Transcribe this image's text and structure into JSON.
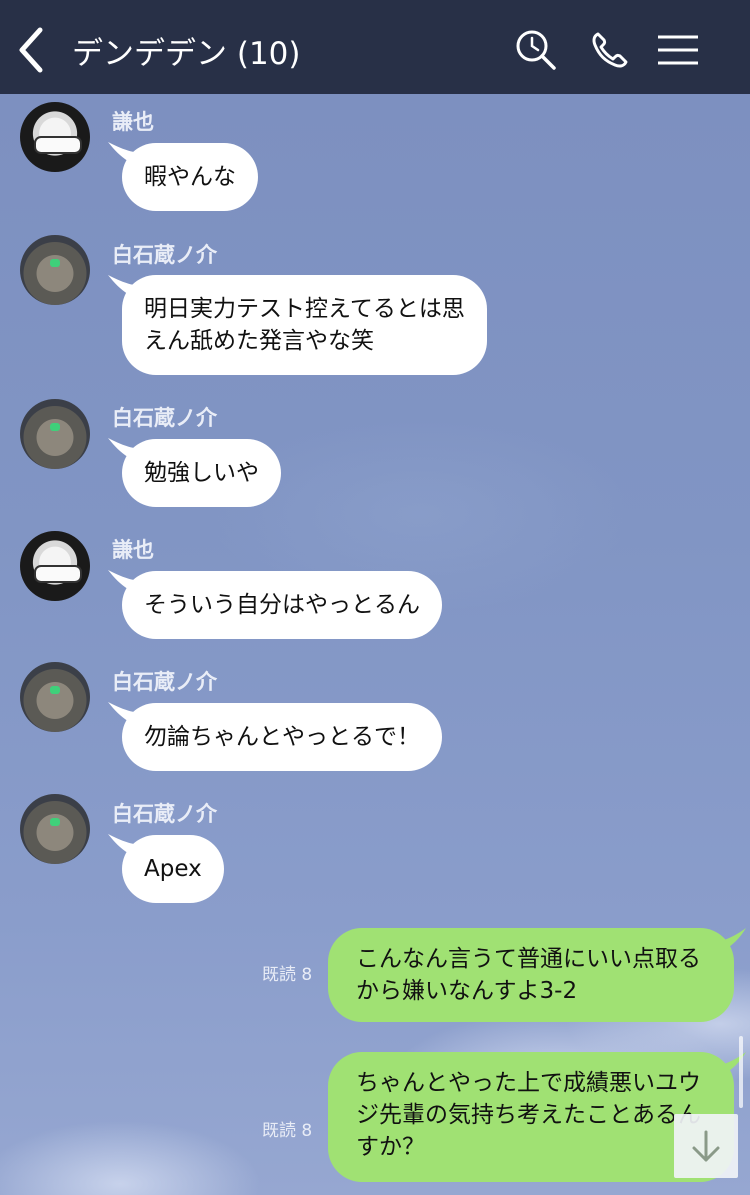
{
  "header": {
    "title": "デンデデン (10)",
    "bg_color": "#283047",
    "icons": [
      "chevron-left-icon",
      "search-icon",
      "phone-icon",
      "menu-icon"
    ]
  },
  "colors": {
    "incoming_bubble": "#ffffff",
    "outgoing_bubble": "#a0e173",
    "chat_background": "#8195c4"
  },
  "messages": [
    {
      "sender": "謙也",
      "text": "暇やんな"
    },
    {
      "sender": "白石蔵ノ介",
      "lines": [
        "明日実力テスト控えてるとは思",
        "えん舐めた発言やな笑"
      ]
    },
    {
      "sender": "白石蔵ノ介",
      "text": "勉強しいや"
    },
    {
      "sender": "謙也",
      "text": "そういう自分はやっとるん"
    },
    {
      "sender": "白石蔵ノ介",
      "text": "勿論ちゃんとやっとるで！"
    },
    {
      "sender": "白石蔵ノ介",
      "text": "Apex"
    }
  ],
  "outgoing": [
    {
      "read": "既読 8",
      "lines": [
        "こんなん言うて普通にいい点取る",
        "から嫌いなんすよ3-2"
      ]
    },
    {
      "read": "既読 8",
      "lines": [
        "ちゃんとやった上で成績悪いユウ",
        "ジ先輩の気持ち考えたことあるん",
        "すか？"
      ]
    }
  ]
}
